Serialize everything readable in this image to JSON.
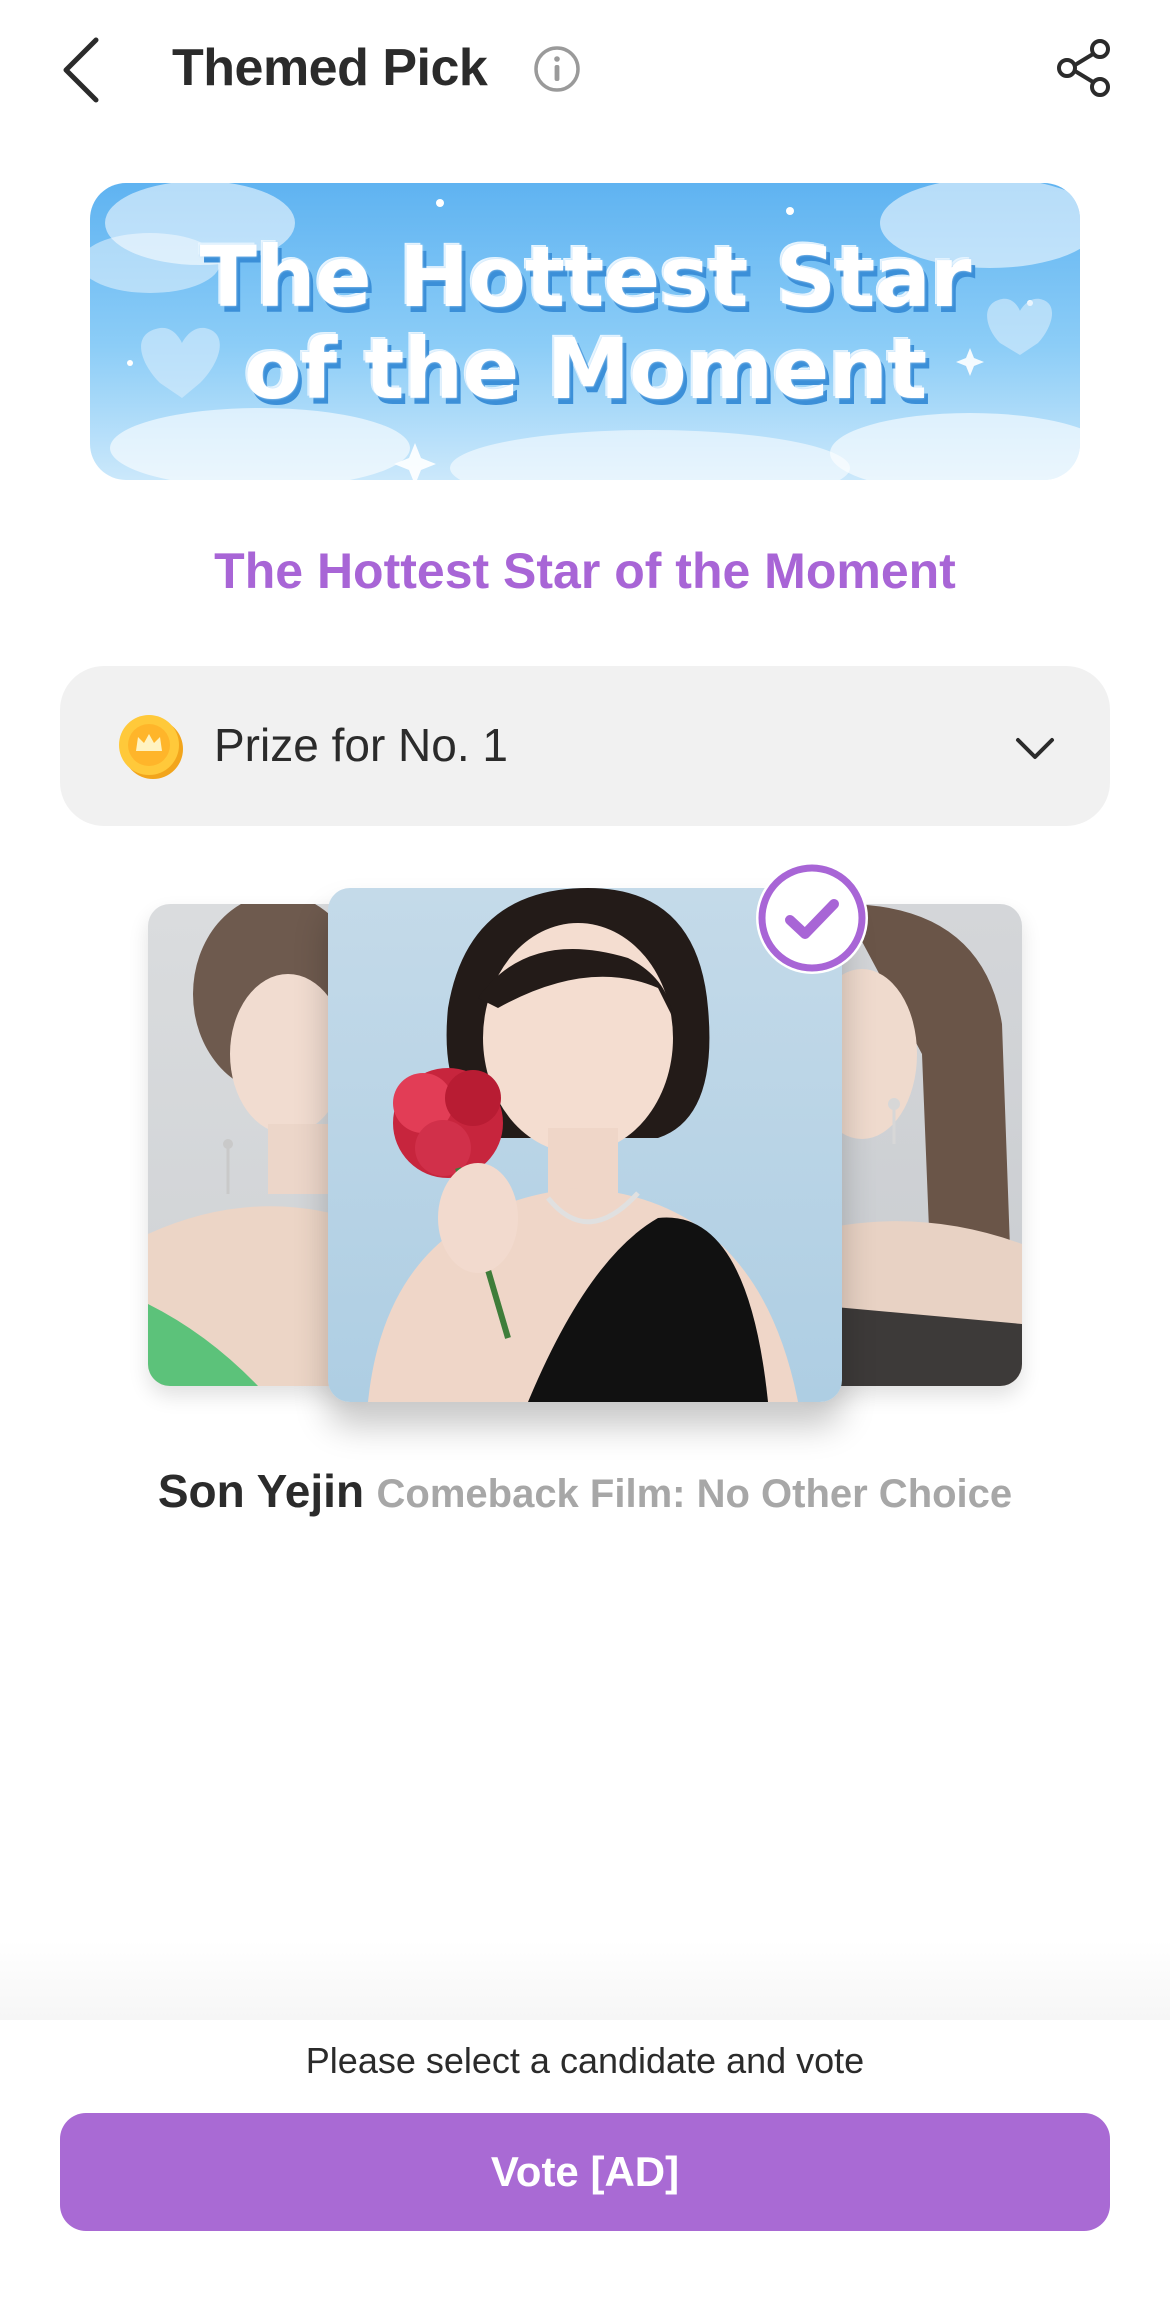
{
  "header": {
    "title": "Themed Pick",
    "back_icon": "chevron-left-icon",
    "info_icon": "info-icon",
    "share_icon": "share-icon"
  },
  "banner": {
    "text_line1": "The Hottest Star",
    "text_line2": "of the Moment"
  },
  "event": {
    "title": "The Hottest Star of the Moment",
    "title_color": "#a865d6"
  },
  "prize": {
    "label": "Prize for No. 1",
    "icon": "coin-icon",
    "toggle_icon": "chevron-down-icon"
  },
  "carousel": {
    "selected_index": 1,
    "selected_icon": "check-circle-icon"
  },
  "candidate": {
    "name": "Son Yejin",
    "description": "Comeback Film: No Other Choice"
  },
  "footer": {
    "prompt": "Please select a candidate and vote",
    "vote_label": "Vote [AD]",
    "accent_color": "#a96ad4"
  }
}
